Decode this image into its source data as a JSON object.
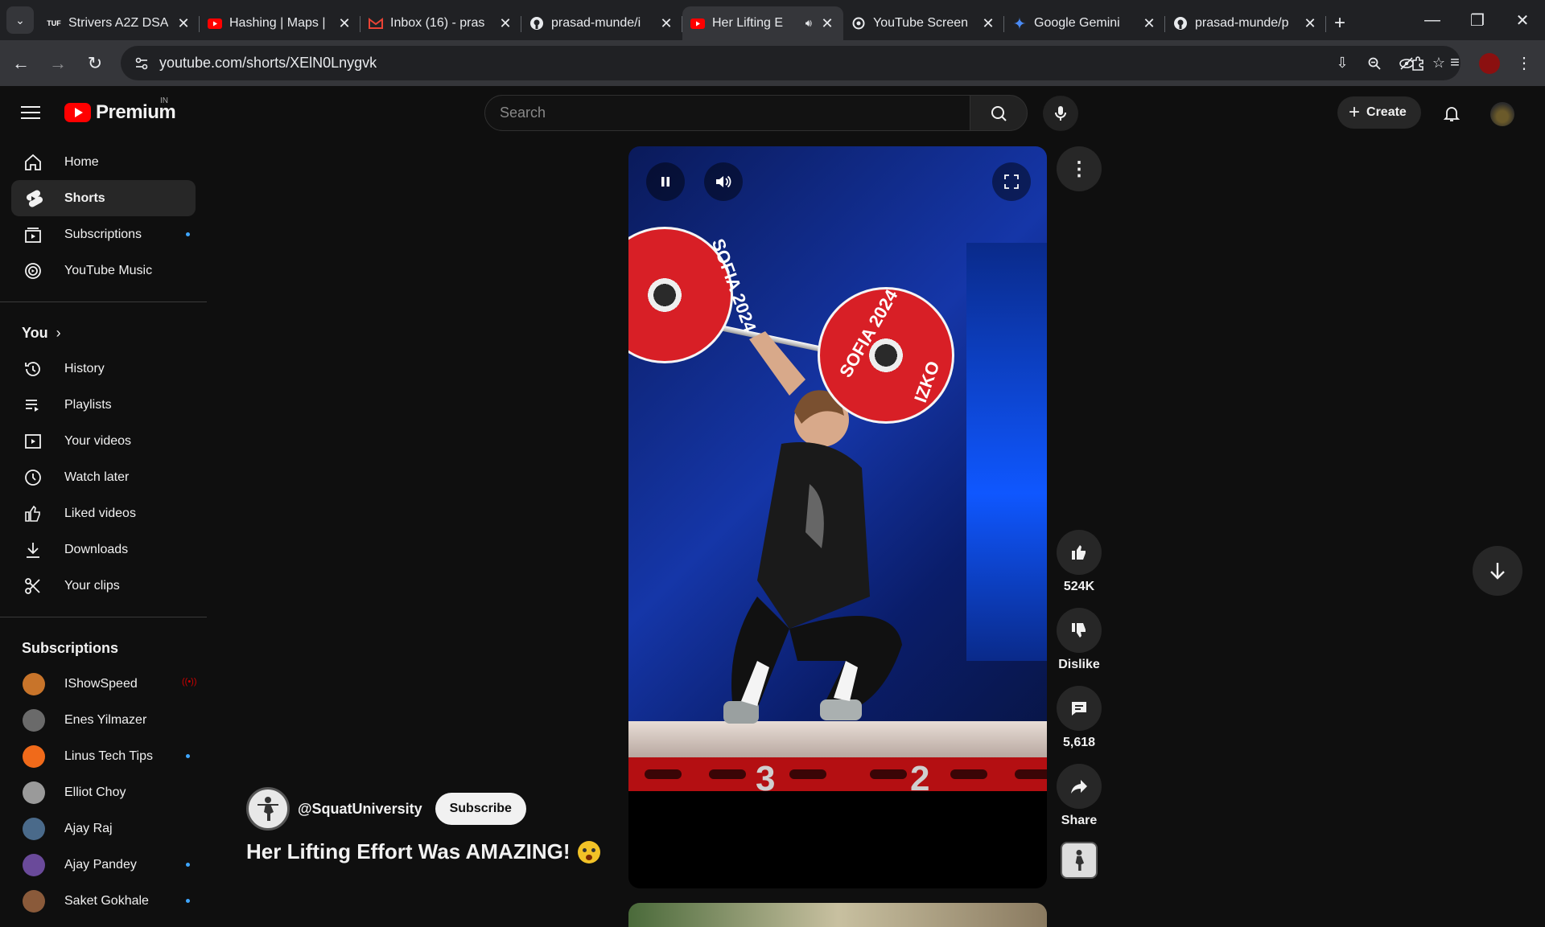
{
  "browser": {
    "tabs": [
      {
        "title": "Strivers A2Z DSA",
        "favicon": "tuf-icon",
        "active": false
      },
      {
        "title": "Hashing | Maps |",
        "favicon": "youtube-icon",
        "active": false
      },
      {
        "title": "Inbox (16) - pras",
        "favicon": "gmail-icon",
        "active": false
      },
      {
        "title": "prasad-munde/i",
        "favicon": "github-icon",
        "active": false
      },
      {
        "title": "Her Lifting E",
        "favicon": "youtube-icon",
        "active": true
      },
      {
        "title": "YouTube Screen",
        "favicon": "openai-icon",
        "active": false
      },
      {
        "title": "Google Gemini",
        "favicon": "gemini-icon",
        "active": false
      },
      {
        "title": "prasad-munde/p",
        "favicon": "github-icon",
        "active": false
      }
    ],
    "tab_close_glyph": "✕",
    "url": "youtube.com/shorts/XElN0Lnygvk"
  },
  "youtube": {
    "logo_text": "Premium",
    "country_code": "IN",
    "search_placeholder": "Search",
    "create_label": "Create",
    "sidebar": {
      "main": [
        {
          "label": "Home",
          "icon": "home-icon",
          "active": false,
          "dot": false
        },
        {
          "label": "Shorts",
          "icon": "shorts-icon",
          "active": true,
          "dot": false
        },
        {
          "label": "Subscriptions",
          "icon": "subscriptions-icon",
          "active": false,
          "dot": true
        },
        {
          "label": "YouTube Music",
          "icon": "music-icon",
          "active": false,
          "dot": false
        }
      ],
      "you_header": "You",
      "you": [
        {
          "label": "History",
          "icon": "history-icon"
        },
        {
          "label": "Playlists",
          "icon": "playlists-icon"
        },
        {
          "label": "Your videos",
          "icon": "your-videos-icon"
        },
        {
          "label": "Watch later",
          "icon": "watch-later-icon"
        },
        {
          "label": "Liked videos",
          "icon": "liked-videos-icon"
        },
        {
          "label": "Downloads",
          "icon": "downloads-icon"
        },
        {
          "label": "Your clips",
          "icon": "clips-icon"
        }
      ],
      "subscriptions_header": "Subscriptions",
      "subscriptions": [
        {
          "name": "IShowSpeed",
          "indicator": "live",
          "color": "#c8742a"
        },
        {
          "name": "Enes Yilmazer",
          "indicator": "",
          "color": "#6a6a6a"
        },
        {
          "name": "Linus Tech Tips",
          "indicator": "dot",
          "color": "#f06a1a"
        },
        {
          "name": "Elliot Choy",
          "indicator": "",
          "color": "#9a9a9a"
        },
        {
          "name": "Ajay Raj",
          "indicator": "",
          "color": "#4a6a8a"
        },
        {
          "name": "Ajay Pandey",
          "indicator": "dot",
          "color": "#6a4a9a"
        },
        {
          "name": "Saket Gokhale",
          "indicator": "dot",
          "color": "#8a5a3a"
        }
      ]
    },
    "short": {
      "channel": "@SquatUniversity",
      "subscribe_label": "Subscribe",
      "title": "Her Lifting Effort Was AMAZING!",
      "video_text": {
        "plate_text_1": "SOFIA 2024",
        "plate_text_2": "SOFIA 2024",
        "plate_brand": "IZKO",
        "platform_num_1": "3",
        "platform_num_2": "2"
      },
      "likes": "524K",
      "dislike_label": "Dislike",
      "comments": "5,618",
      "share_label": "Share"
    }
  }
}
